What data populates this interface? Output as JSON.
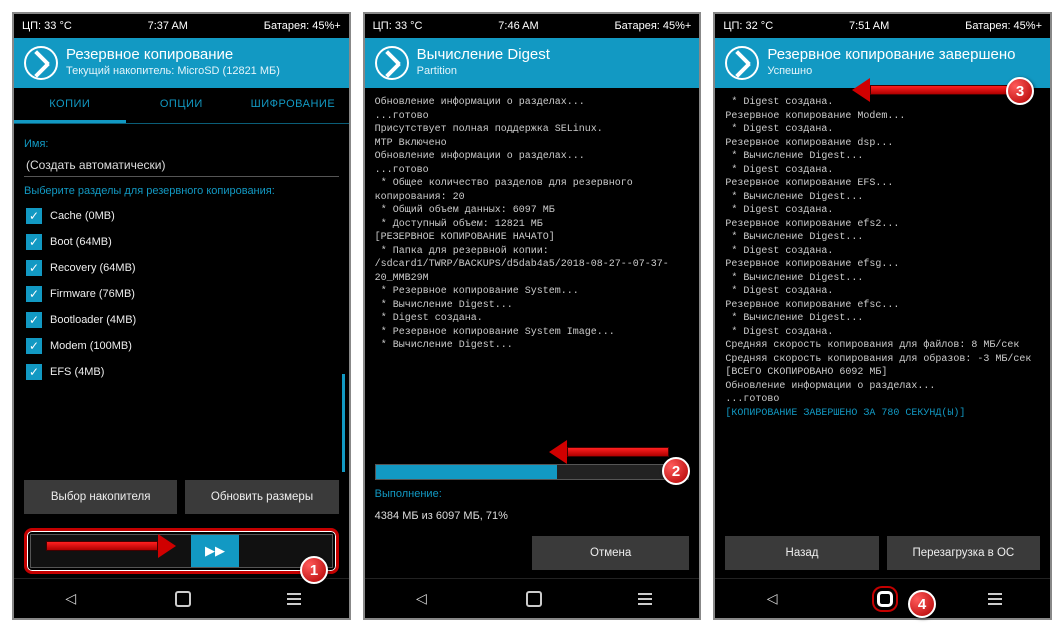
{
  "screen1": {
    "status": {
      "cpu": "ЦП: 33 °C",
      "time": "7:37 AM",
      "battery": "Батарея: 45%+"
    },
    "title": "Резервное копирование",
    "subtitle": "Текущий накопитель: MicroSD (12821 МБ)",
    "tabs": [
      "КОПИИ",
      "ОПЦИИ",
      "ШИФРОВАНИЕ"
    ],
    "name_label": "Имя:",
    "name_value": "(Создать автоматически)",
    "select_label": "Выберите разделы для резервного копирования:",
    "partitions": [
      "Cache (0MB)",
      "Boot (64MB)",
      "Recovery (64MB)",
      "Firmware (76MB)",
      "Bootloader (4MB)",
      "Modem (100MB)",
      "EFS (4MB)"
    ],
    "btn_storage": "Выбор накопителя",
    "btn_refresh": "Обновить размеры"
  },
  "screen2": {
    "status": {
      "cpu": "ЦП: 33 °C",
      "time": "7:46 AM",
      "battery": "Батарея: 45%+"
    },
    "title": "Вычисление Digest",
    "subtitle": "Partition",
    "log": "Обновление информации о разделах...\n...готово\nПрисутствует полная поддержка SELinux.\nМТР Включено\nОбновление информации о разделах...\n...готово\n * Общее количество разделов для резервного копирования: 20\n * Общий объем данных: 6097 МБ\n * Доступный объем: 12821 МБ\n[РЕЗЕРВНОЕ КОПИРОВАНИЕ НАЧАТО]\n * Папка для резервной копии: /sdcard1/TWRP/BACKUPS/d5dab4a5/2018-08-27--07-37-20_MMB29M\n * Резервное копирование System...\n * Вычисление Digest...\n * Digest создана.\n * Резервное копирование System Image...\n * Вычисление Digest...",
    "progress_label": "Выполнение:",
    "progress_text": "4384 МБ из 6097 МБ, 71%",
    "progress_pct": 58,
    "btn_cancel": "Отмена"
  },
  "screen3": {
    "status": {
      "cpu": "ЦП: 32 °C",
      "time": "7:51 AM",
      "battery": "Батарея: 45%+"
    },
    "title": "Резервное копирование завершено",
    "subtitle": "Успешно",
    "log_plain": " * Digest создана.\nРезервное копирование Modem...\n * Digest создана.\nРезервное копирование dsp...\n * Вычисление Digest...\n * Digest создана.\nРезервное копирование EFS...\n * Вычисление Digest...\n * Digest создана.\nРезервное копирование efs2...\n * Вычисление Digest...\n * Digest создана.\nРезервное копирование efsg...\n * Вычисление Digest...\n * Digest создана.\nРезервное копирование efsc...\n * Вычисление Digest...\n * Digest создана.\nСредняя скорость копирования для файлов: 8 МБ/сек\nСредняя скорость копирования для образов: -3 МБ/сек\n[ВСЕГО СКОПИРОВАНО 6092 МБ]\nОбновление информации о разделах...\n...готово",
    "log_hl": "[КОПИРОВАНИЕ ЗАВЕРШЕНО ЗА 780 СЕКУНД(Ы)]",
    "btn_back": "Назад",
    "btn_reboot": "Перезагрузка в ОС"
  },
  "badges": {
    "n1": "1",
    "n2": "2",
    "n3": "3",
    "n4": "4"
  }
}
